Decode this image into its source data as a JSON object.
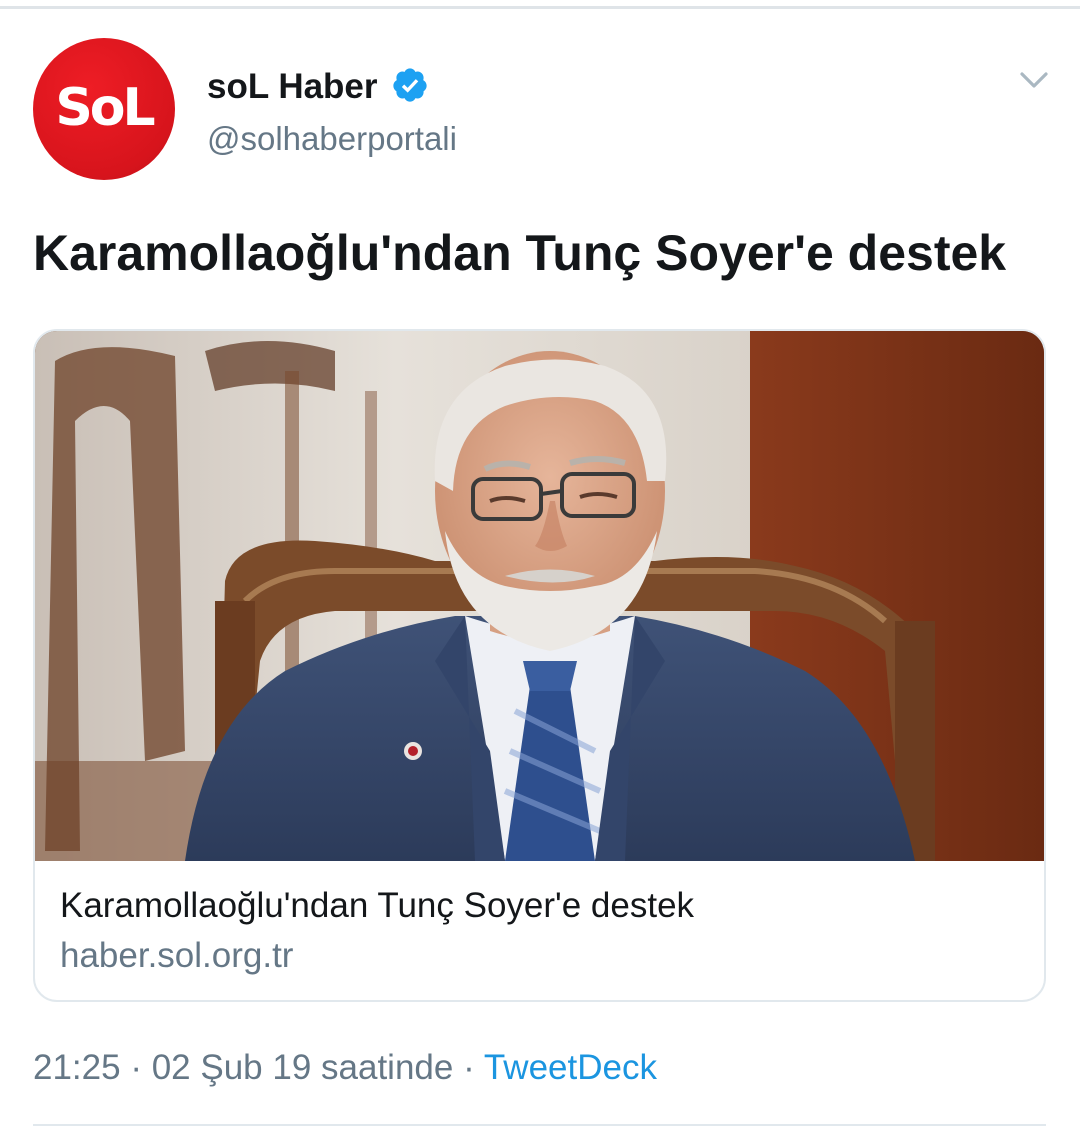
{
  "tweet": {
    "author": {
      "avatar_text": "SoL",
      "display_name": "soL Haber",
      "verified": true,
      "handle": "@solhaberportali"
    },
    "text": "Karamollaoğlu'ndan Tunç Soyer'e destek",
    "card": {
      "image_subject": "elderly man in a blue tweed jacket seated in a carved wooden chair",
      "title": "Karamollaoğlu'ndan Tunç Soyer'e destek",
      "domain": "haber.sol.org.tr"
    },
    "meta": {
      "time": "21:25",
      "separator": "·",
      "date": "02 Şub 19 saatinde",
      "separator2": "·",
      "source": "TweetDeck"
    },
    "icons": {
      "verified": "verified-badge-icon",
      "menu": "chevron-down-icon"
    }
  },
  "colors": {
    "brand_red": "#d7141c",
    "link_blue": "#1b95e0",
    "secondary_text": "#657786",
    "primary_text": "#14171a",
    "border": "#e1e8ed"
  }
}
